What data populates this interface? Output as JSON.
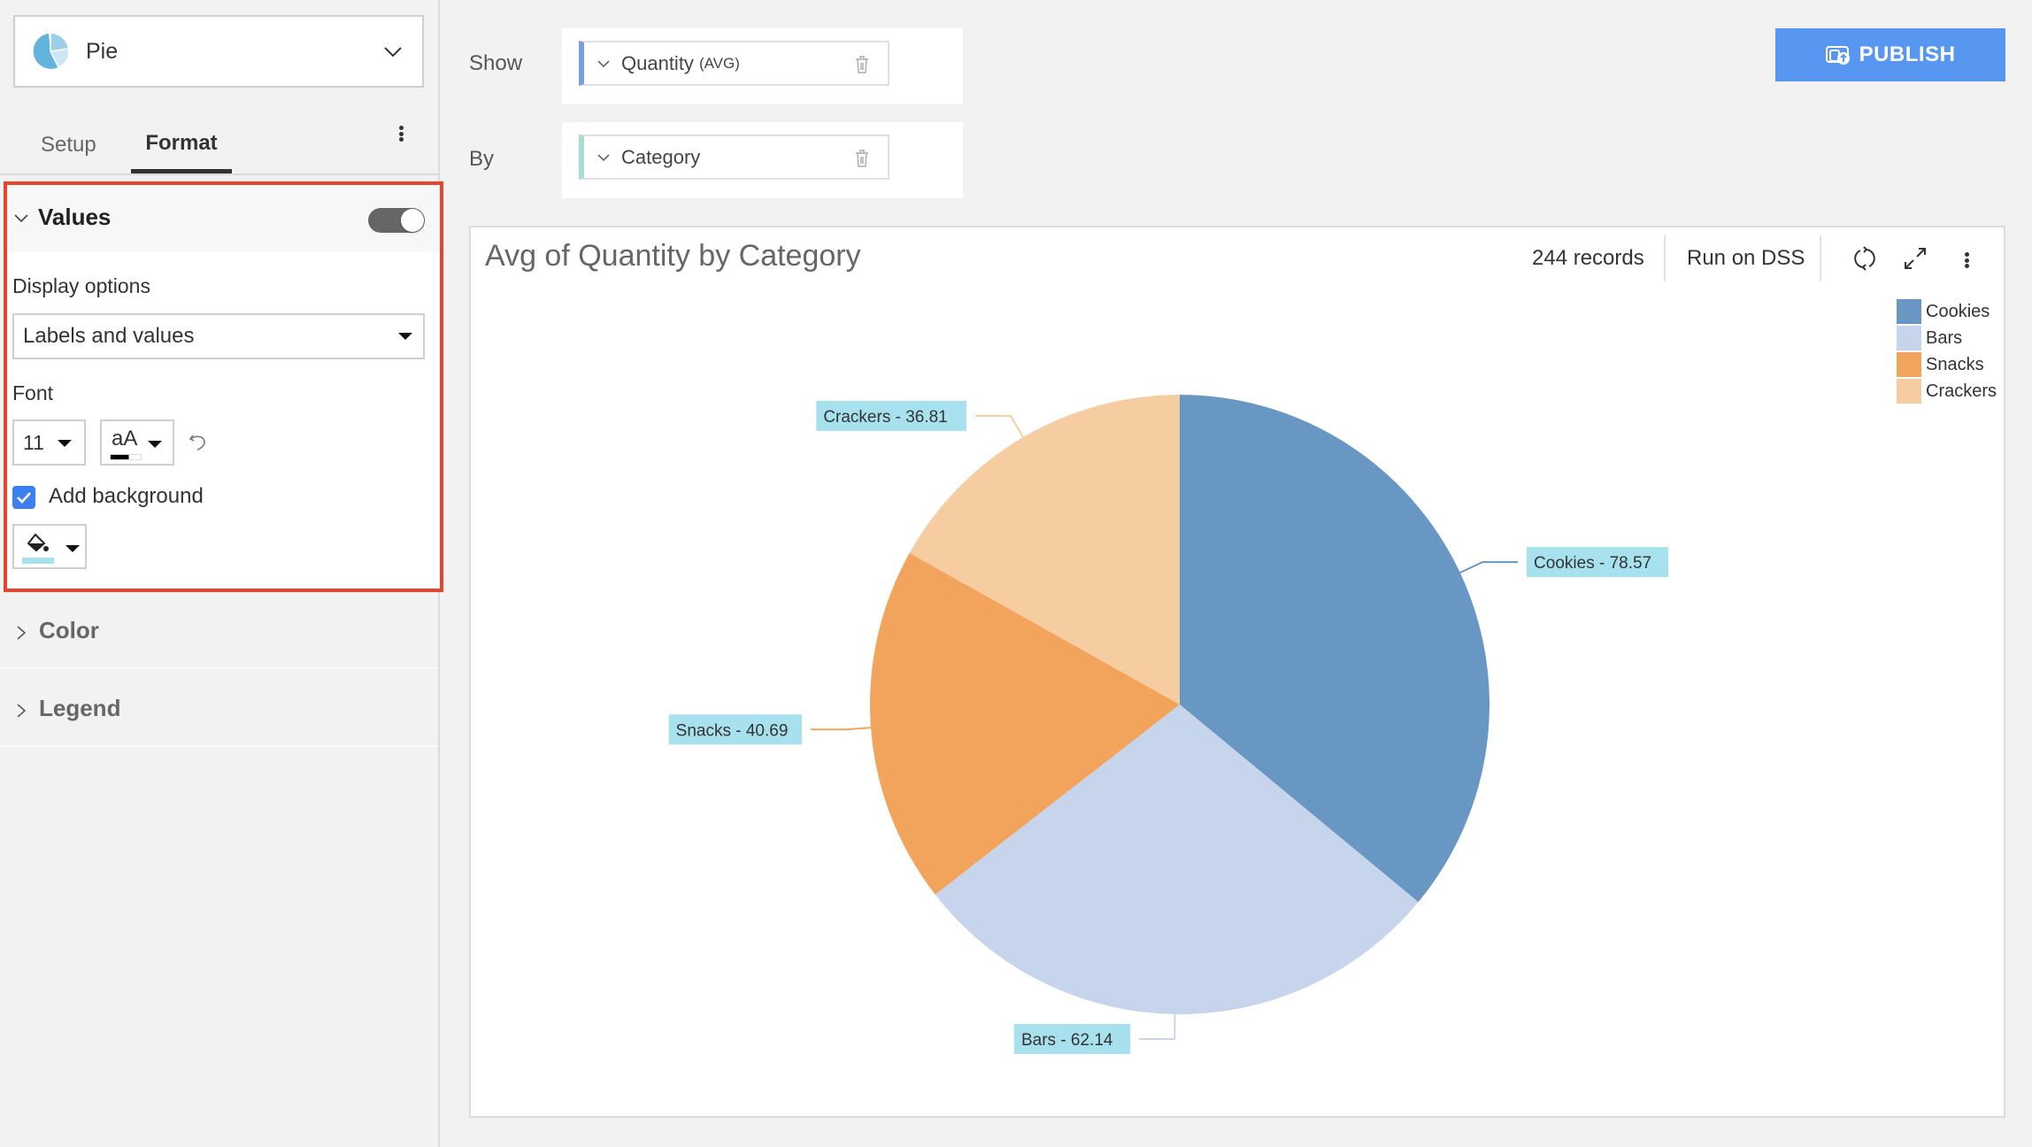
{
  "sidebar": {
    "chart_type": {
      "label": "Pie",
      "icon": "pie-chart-icon"
    },
    "tabs": [
      {
        "label": "Setup",
        "active": false
      },
      {
        "label": "Format",
        "active": true
      }
    ],
    "values_section": {
      "title": "Values",
      "enabled": true,
      "display_options_label": "Display options",
      "display_options_value": "Labels and values",
      "font_label": "Font",
      "font_size": "11",
      "font_color_label": "aA",
      "font_color": "#000000",
      "add_background_label": "Add background",
      "add_background_checked": true,
      "background_color": "#a7e1ed"
    },
    "collapsed_sections": [
      {
        "label": "Color"
      },
      {
        "label": "Legend"
      }
    ]
  },
  "shelves": {
    "show_label": "Show",
    "show_field": {
      "name": "Quantity",
      "aggregation": "(AVG)"
    },
    "by_label": "By",
    "by_field": {
      "name": "Category"
    }
  },
  "toolbar": {
    "publish_label": "PUBLISH",
    "publish_color": "#5797f2"
  },
  "chart_header": {
    "records": "244 records",
    "run_on": "Run on DSS"
  },
  "chart_data": {
    "type": "pie",
    "title": "Avg of Quantity by Category",
    "categories": [
      "Cookies",
      "Bars",
      "Snacks",
      "Crackers"
    ],
    "values": [
      78.57,
      62.14,
      40.69,
      36.81
    ],
    "colors": [
      "#6897c4",
      "#c6d5eb",
      "#f2a45d",
      "#f6cda1"
    ],
    "labels": [
      "Cookies - 78.57",
      "Bars - 62.14",
      "Snacks - 40.69",
      "Crackers - 36.81"
    ],
    "label_background": "#a7e1ed",
    "legend": {
      "position": "top-right",
      "entries": [
        "Cookies",
        "Bars",
        "Snacks",
        "Crackers"
      ]
    },
    "start_angle": "12 o'clock",
    "direction": "clockwise"
  }
}
